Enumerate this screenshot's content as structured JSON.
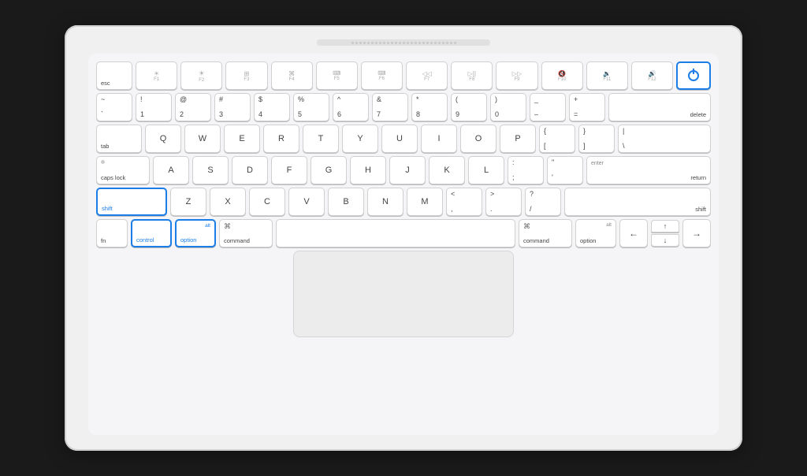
{
  "keyboard": {
    "rows": {
      "fn_row": [
        "esc",
        "F1",
        "F2",
        "F3",
        "F4",
        "F5",
        "F6",
        "F7",
        "F8",
        "F9",
        "F10",
        "F11",
        "F12",
        "power"
      ],
      "num_row": [
        "~`",
        "!1",
        "@2",
        "#3",
        "$4",
        "%5",
        "^6",
        "&7",
        "*8",
        "(9",
        ")0",
        "_-",
        "+=",
        "delete"
      ],
      "qwerty": [
        "tab",
        "Q",
        "W",
        "E",
        "R",
        "T",
        "Y",
        "U",
        "I",
        "O",
        "P",
        "{[",
        "}]",
        "|\\ "
      ],
      "home": [
        "caps lock",
        "A",
        "S",
        "D",
        "F",
        "G",
        "H",
        "J",
        "K",
        "L",
        ":;",
        "\"'",
        "enter return"
      ],
      "shift_row": [
        "shift",
        "Z",
        "X",
        "C",
        "V",
        "B",
        "N",
        "M",
        "<,",
        ">.",
        "?/",
        "shift"
      ],
      "bottom": [
        "fn",
        "control",
        "option",
        "command",
        "",
        "command",
        "option",
        "←",
        "↑↓",
        "→"
      ]
    },
    "highlighted": [
      "shift-left",
      "control",
      "option-left"
    ],
    "power_highlighted": true
  }
}
